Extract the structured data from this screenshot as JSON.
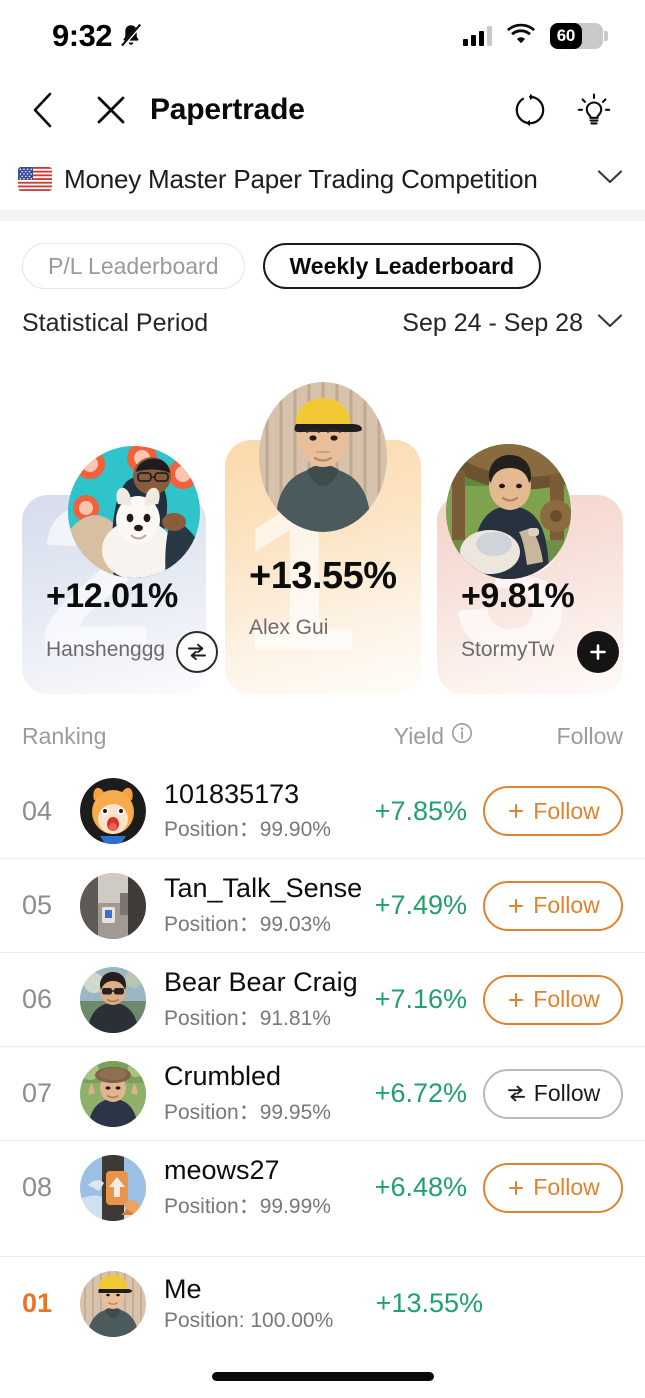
{
  "status_bar": {
    "time": "9:32",
    "bell_icon": "bell-muted-icon",
    "signal_icon": "cellular-signal-icon",
    "wifi_icon": "wifi-icon",
    "battery_level": "60",
    "battery_percent": 60
  },
  "nav": {
    "back_icon": "chevron-left-icon",
    "close_icon": "close-x-icon",
    "title": "Papertrade",
    "refresh_icon": "refresh-sync-icon",
    "tips_icon": "lightbulb-icon"
  },
  "competition": {
    "flag_icon": "us-flag-icon",
    "name": "Money Master Paper Trading Competition",
    "chevron_icon": "chevron-down-icon"
  },
  "tabs": [
    {
      "label": "P/L Leaderboard",
      "active": false
    },
    {
      "label": "Weekly Leaderboard",
      "active": true
    }
  ],
  "period": {
    "label": "Statistical Period",
    "value": "Sep 24 - Sep 28",
    "chevron_icon": "chevron-down-icon"
  },
  "podium": [
    {
      "rank": "1",
      "name": "Alex Gui",
      "yield": "+13.55%",
      "follow_state": "none",
      "card_color": "#fbd9ab"
    },
    {
      "rank": "2",
      "name": "Hanshenggg",
      "yield": "+12.01%",
      "follow_state": "mutual",
      "follow_icon": "swap-arrows-icon",
      "card_color": "#d5dcec"
    },
    {
      "rank": "3",
      "name": "StormyTw",
      "yield": "+9.81%",
      "follow_state": "not-following",
      "follow_icon": "plus-icon",
      "card_color": "#f3d3ca"
    }
  ],
  "list_header": {
    "ranking": "Ranking",
    "yield": "Yield",
    "yield_info_icon": "info-circle-icon",
    "follow": "Follow"
  },
  "rows": [
    {
      "rank": "04",
      "name": "101835173",
      "position": "Position：99.90%",
      "yield": "+7.85%",
      "follow_label": "Follow",
      "follow_style": "orange",
      "follow_icon": "plus-icon"
    },
    {
      "rank": "05",
      "name": "Tan_Talk_Sense",
      "position": "Position：99.03%",
      "yield": "+7.49%",
      "follow_label": "Follow",
      "follow_style": "orange",
      "follow_icon": "plus-icon"
    },
    {
      "rank": "06",
      "name": "Bear Bear Craig",
      "position": "Position：91.81%",
      "yield": "+7.16%",
      "follow_label": "Follow",
      "follow_style": "orange",
      "follow_icon": "plus-icon"
    },
    {
      "rank": "07",
      "name": "Crumbled",
      "position": "Position：99.95%",
      "yield": "+6.72%",
      "follow_label": "Follow",
      "follow_style": "dark",
      "follow_icon": "swap-arrows-icon"
    },
    {
      "rank": "08",
      "name": "meows27",
      "position": "Position：99.99%",
      "yield": "+6.48%",
      "follow_label": "Follow",
      "follow_style": "orange",
      "follow_icon": "plus-icon"
    }
  ],
  "me_row": {
    "rank": "01",
    "name": "Me",
    "position": "Position: 100.00%",
    "yield": "+13.55%"
  },
  "colors": {
    "yield_green": "#22a06b",
    "follow_orange": "#e0822e",
    "me_rank_orange": "#e8762a",
    "text_primary": "#0d0d0d",
    "text_muted": "#8d8d8d"
  }
}
